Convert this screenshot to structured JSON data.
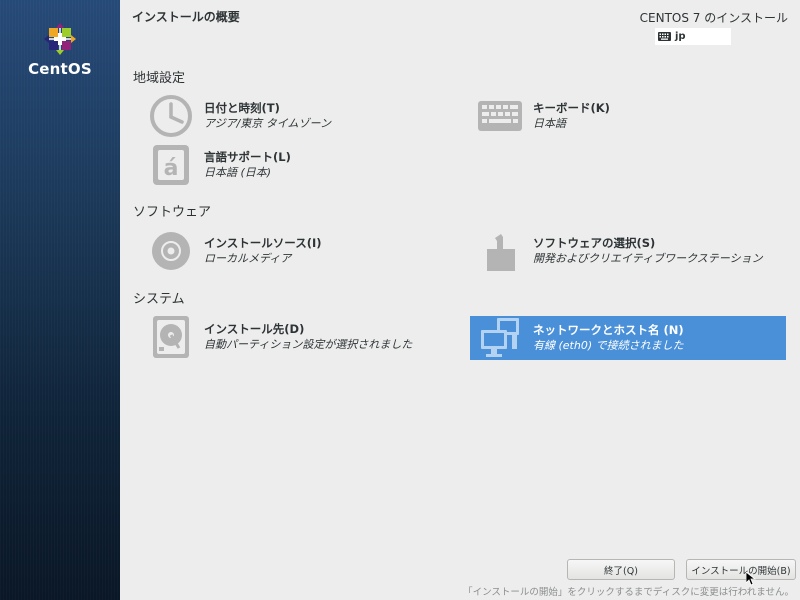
{
  "sidebar": {
    "logo_text": "CentOS",
    "logo_icon": "centos-logo-icon"
  },
  "header": {
    "hub_title": "インストールの概要",
    "product_title": "CENTOS 7 のインストール",
    "keyboard_layout": "jp"
  },
  "categories": [
    {
      "title": "地域設定",
      "spokes": [
        {
          "name": "日付と時刻(T)",
          "status": "アジア/東京 タイムゾーン",
          "icon": "clock-icon"
        },
        {
          "name": "キーボード(K)",
          "status": "日本語",
          "icon": "keyboard-icon"
        },
        {
          "name": "言語サポート(L)",
          "status": "日本語 (日本)",
          "icon": "language-icon"
        }
      ]
    },
    {
      "title": "ソフトウェア",
      "spokes": [
        {
          "name": "インストールソース(I)",
          "status": "ローカルメディア",
          "icon": "disc-icon"
        },
        {
          "name": "ソフトウェアの選択(S)",
          "status": "開発およびクリエイティブワークステーション",
          "icon": "package-icon"
        }
      ]
    },
    {
      "title": "システム",
      "spokes": [
        {
          "name": "インストール先(D)",
          "status": "自動パーティション設定が選択されました",
          "icon": "harddisk-icon"
        },
        {
          "name": "ネットワークとホスト名 (N)",
          "status": "有線 (eth0) で接続されました",
          "icon": "network-icon"
        }
      ]
    }
  ],
  "footer": {
    "quit_label": "終了(Q)",
    "begin_label": "インストールの開始(B)",
    "note": "「インストールの開始」をクリックするまでディスクに変更は行われません。"
  },
  "colors": {
    "selected": "#4a90d9",
    "background": "#ededed",
    "icon_gray": "#b4b4b4"
  }
}
